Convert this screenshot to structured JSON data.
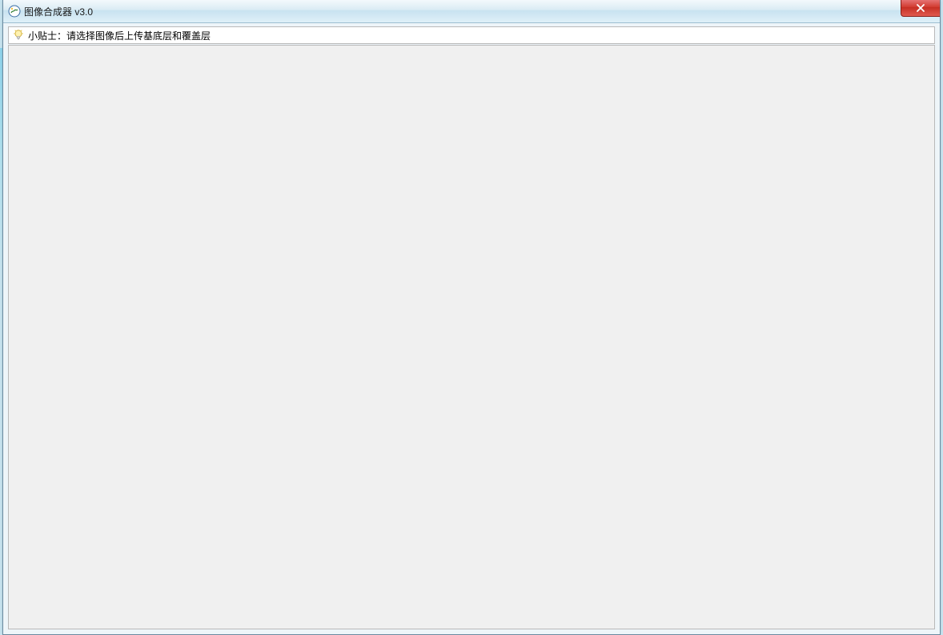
{
  "window": {
    "title": "图像合成器 v3.0"
  },
  "tip": {
    "text": "小贴士：请选择图像后上传基底层和覆盖层"
  }
}
